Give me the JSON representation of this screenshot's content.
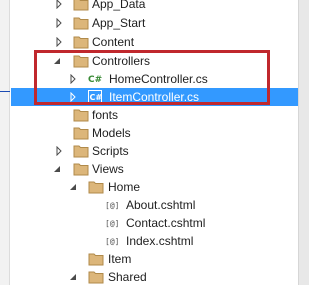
{
  "solution_explorer": {
    "items": [
      {
        "id": "app-data",
        "label": "App_Data",
        "type": "folder",
        "expander": "right"
      },
      {
        "id": "app-start",
        "label": "App_Start",
        "type": "folder",
        "expander": "right"
      },
      {
        "id": "content",
        "label": "Content",
        "type": "folder",
        "expander": "right"
      },
      {
        "id": "controllers",
        "label": "Controllers",
        "type": "folder",
        "expander": "down"
      },
      {
        "id": "homecontroller",
        "label": "HomeController.cs",
        "type": "cs-file",
        "expander": "right"
      },
      {
        "id": "itemcontroller",
        "label": "ItemController.cs",
        "type": "cs-file",
        "expander": "right",
        "selected": true
      },
      {
        "id": "fonts",
        "label": "fonts",
        "type": "folder",
        "expander": "none"
      },
      {
        "id": "models",
        "label": "Models",
        "type": "folder",
        "expander": "none"
      },
      {
        "id": "scripts",
        "label": "Scripts",
        "type": "folder",
        "expander": "right"
      },
      {
        "id": "views",
        "label": "Views",
        "type": "folder",
        "expander": "down"
      },
      {
        "id": "home",
        "label": "Home",
        "type": "folder",
        "expander": "down"
      },
      {
        "id": "about",
        "label": "About.cshtml",
        "type": "cshtml",
        "expander": "none"
      },
      {
        "id": "contact",
        "label": "Contact.cshtml",
        "type": "cshtml",
        "expander": "none"
      },
      {
        "id": "index",
        "label": "Index.cshtml",
        "type": "cshtml",
        "expander": "none"
      },
      {
        "id": "item",
        "label": "Item",
        "type": "folder",
        "expander": "none"
      },
      {
        "id": "shared",
        "label": "Shared",
        "type": "folder",
        "expander": "down"
      }
    ]
  },
  "icons": {
    "folder": "folder-icon",
    "cs-file": "csharp-file-icon",
    "cshtml": "razor-view-icon",
    "expander-right": "triangle-right-icon",
    "expander-down": "triangle-down-icon"
  },
  "colors": {
    "selection": "#3399ff",
    "folder_fill": "#dcb67a",
    "annotation_box": "#c0282d"
  },
  "annotation": {
    "highlight": "red rectangle around Controllers, HomeController.cs and ItemController.cs"
  }
}
